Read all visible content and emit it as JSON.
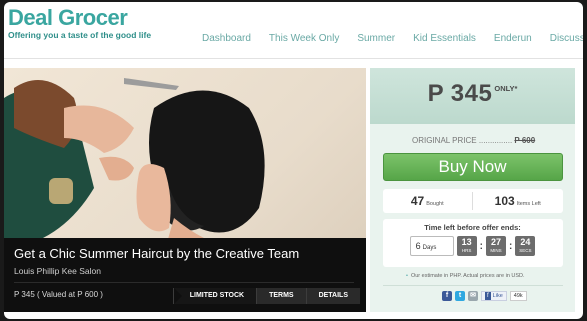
{
  "brand": {
    "name_part1": "Deal",
    "name_part2": "Grocer",
    "tagline": "Offering you a taste of the good life"
  },
  "nav": [
    {
      "label": "Dashboard"
    },
    {
      "label": "This Week Only"
    },
    {
      "label": "Summer"
    },
    {
      "label": "Kid Essentials"
    },
    {
      "label": "Enderun"
    },
    {
      "label": "Discussions"
    }
  ],
  "deal": {
    "title": "Get a Chic Summer Haircut by the Creative Team",
    "merchant": "Louis Phillip Kee Salon",
    "price_note": "P 345 ( Valued at P 600 )",
    "tabs": {
      "limited": "LIMITED STOCK",
      "terms": "TERMS",
      "details": "DETAILS"
    }
  },
  "pricing": {
    "price": "P 345",
    "only": "ONLY*",
    "original_label": "ORIGINAL PRICE ...............",
    "original_value": "P 600",
    "buy_label": "Buy Now"
  },
  "stats": {
    "bought": "47",
    "bought_label": "Bought",
    "items_left": "103",
    "items_left_label": "Items Left"
  },
  "timer": {
    "label": "Time left before offer ends:",
    "days": "6",
    "days_label": "Days",
    "hrs": "13",
    "hrs_label": "HRS",
    "mins": "27",
    "mins_label": "MINS",
    "secs": "24",
    "secs_label": "SECS"
  },
  "note": "Our estimate in PHP. Actual prices are in USD.",
  "share": {
    "facebook": "f",
    "twitter": "t",
    "mail": "✉",
    "like_label": "Like",
    "like_count": "49k"
  },
  "colors": {
    "brand": "#3aa6a0",
    "buy": "#5fae4f",
    "side_bg": "#e9f3ee"
  }
}
